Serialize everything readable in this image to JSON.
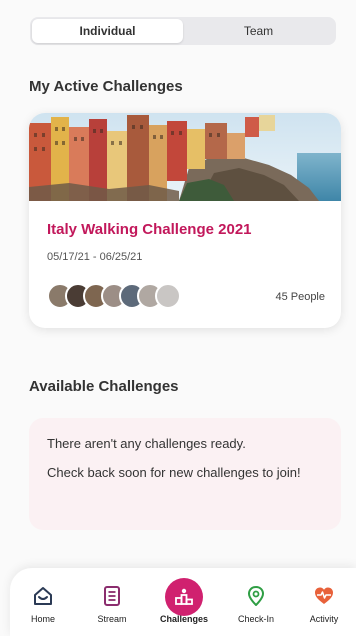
{
  "segments": {
    "individual": "Individual",
    "team": "Team",
    "selected": "Individual"
  },
  "active_section": {
    "title": "My Active Challenges"
  },
  "challenge": {
    "name": "Italy Walking Challenge 2021",
    "dates": "05/17/21 - 06/25/21",
    "people": "45 People"
  },
  "available_section": {
    "title": "Available Challenges"
  },
  "empty_state": {
    "line1": "There aren't any challenges ready.",
    "line2": "Check back soon for new challenges to join!"
  },
  "tabs": [
    {
      "label": "Home",
      "icon": "home-icon",
      "color": "#2b3a55"
    },
    {
      "label": "Stream",
      "icon": "stream-icon",
      "color": "#8b2d6e"
    },
    {
      "label": "Challenges",
      "icon": "challenges-icon",
      "color": "#d0216f",
      "active": true
    },
    {
      "label": "Check-In",
      "icon": "location-pin-icon",
      "color": "#2f9e44"
    },
    {
      "label": "Activity",
      "icon": "heartbeat-icon",
      "color": "#e8613a"
    }
  ],
  "colors": {
    "accent": "#d0216f",
    "challenge_title": "#c2185b",
    "empty_bg": "#fbf1f3"
  }
}
